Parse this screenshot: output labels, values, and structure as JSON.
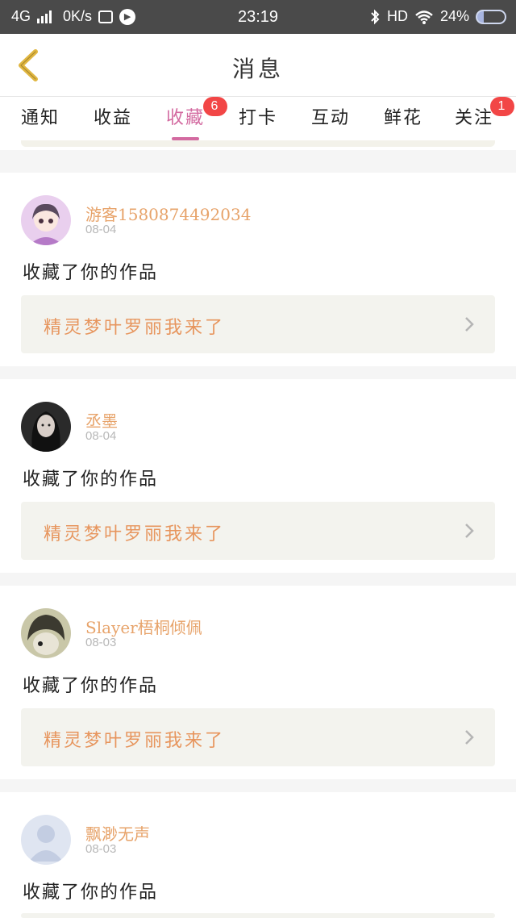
{
  "status_bar": {
    "network": "4G",
    "speed": "0K/s",
    "time": "23:19",
    "hd": "HD",
    "battery": "24%",
    "icons": [
      "signal-icon",
      "data-icon",
      "play-icon",
      "bluetooth-icon",
      "wifi-icon",
      "battery-icon"
    ]
  },
  "header": {
    "title": "消息",
    "back_icon": "back-chevron-icon"
  },
  "tabs": [
    {
      "label": "通知",
      "badge": ""
    },
    {
      "label": "收益",
      "badge": ""
    },
    {
      "label": "收藏",
      "badge": "6",
      "active": true
    },
    {
      "label": "打卡",
      "badge": ""
    },
    {
      "label": "互动",
      "badge": ""
    },
    {
      "label": "鲜花",
      "badge": ""
    },
    {
      "label": "关注",
      "badge": "1"
    }
  ],
  "messages": [
    {
      "user": "游客1580874492034",
      "date": "08-04",
      "action": "收藏了你的作品",
      "work": "精灵梦叶罗丽我来了"
    },
    {
      "user": "丞墨",
      "date": "08-04",
      "action": "收藏了你的作品",
      "work": "精灵梦叶罗丽我来了"
    },
    {
      "user": "Slayer梧桐倾佩",
      "date": "08-03",
      "action": "收藏了你的作品",
      "work": "精灵梦叶罗丽我来了"
    },
    {
      "user": "飘渺无声",
      "date": "08-03",
      "action": "收藏了你的作品",
      "work": ""
    }
  ],
  "colors": {
    "accent": "#d36aa0",
    "username": "#e7a36a",
    "work_title": "#e7955d",
    "badge": "#f24646",
    "back_icon": "#e0b640"
  }
}
